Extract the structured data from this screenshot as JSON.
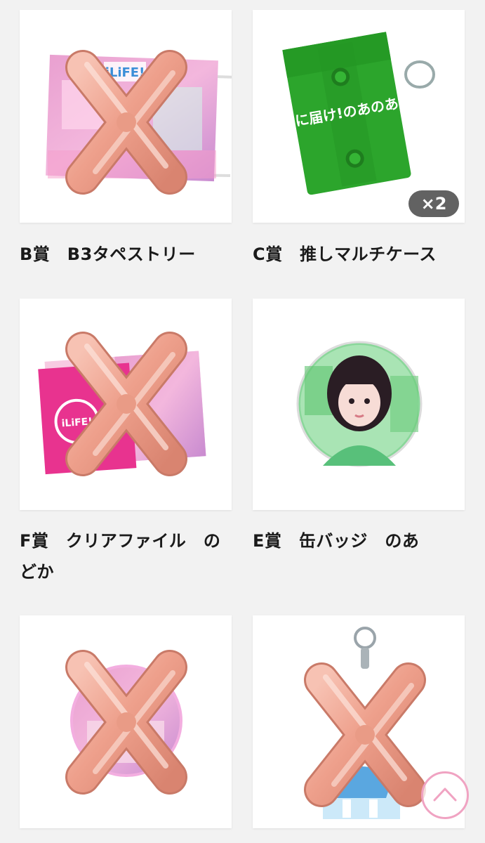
{
  "items": [
    {
      "label": "B賞　B3タペストリー",
      "image": "b3-tapestry-photo",
      "sold_out": true
    },
    {
      "label": "C賞　推しマルチケース",
      "image": "multi-case-photo",
      "sold_out": false,
      "badge": "×2",
      "case_text": "君に届け!のあのあい"
    },
    {
      "label": "F賞　クリアファイル　のどか",
      "image": "clear-file-photo",
      "sold_out": true
    },
    {
      "label": "E賞　缶バッジ　のあ",
      "image": "can-badge-photo",
      "sold_out": false
    },
    {
      "label": "",
      "image": "round-item-photo",
      "sold_out": true
    },
    {
      "label": "",
      "image": "acrylic-keychain-photo",
      "sold_out": true
    }
  ],
  "logo_text": "iLiFE!",
  "colors": {
    "background": "#f2f2f2",
    "card": "#ffffff",
    "sold_out_balloon": "#f0a08a",
    "scroll_top_ring": "#f0a3c2",
    "case_green": "#2ca52c"
  },
  "icons": {
    "sold_out_mark": "x-balloon-icon",
    "scroll_top": "chevron-up-icon"
  }
}
